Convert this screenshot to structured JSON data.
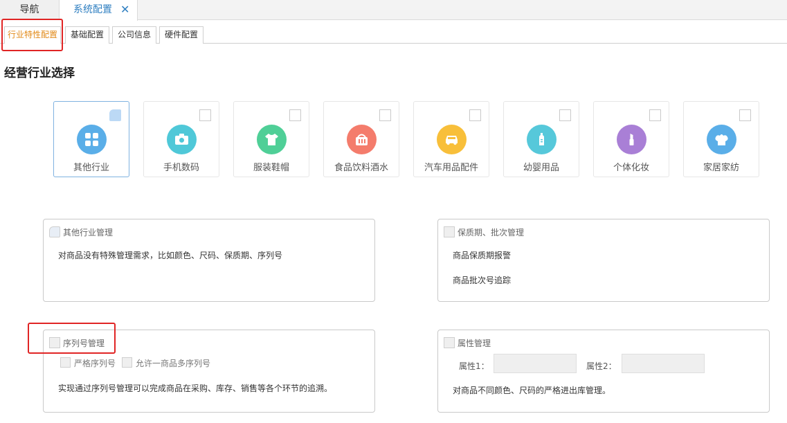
{
  "top_tabs": {
    "nav_label": "导航",
    "system_label": "系统配置",
    "close_glyph": "✕"
  },
  "sub_tabs": [
    {
      "label": "行业特性配置",
      "active": true
    },
    {
      "label": "基础配置",
      "active": false
    },
    {
      "label": "公司信息",
      "active": false
    },
    {
      "label": "硬件配置",
      "active": false
    }
  ],
  "section_title": "经营行业选择",
  "industries": [
    {
      "label": "其他行业",
      "icon": "grid-icon",
      "color": "#5aaee8",
      "selected": true
    },
    {
      "label": "手机数码",
      "icon": "camera-icon",
      "color": "#4fc8d8",
      "selected": false
    },
    {
      "label": "服装鞋帽",
      "icon": "shirt-icon",
      "color": "#4fcf97",
      "selected": false
    },
    {
      "label": "食品饮料酒水",
      "icon": "food-basket-icon",
      "color": "#f47c6c",
      "selected": false
    },
    {
      "label": "汽车用品配件",
      "icon": "car-icon",
      "color": "#f8bf3a",
      "selected": false
    },
    {
      "label": "幼婴用品",
      "icon": "baby-bottle-icon",
      "color": "#56c8da",
      "selected": false
    },
    {
      "label": "个体化妆",
      "icon": "lipstick-icon",
      "color": "#a97fd6",
      "selected": false
    },
    {
      "label": "家居家纺",
      "icon": "chef-hat-icon",
      "color": "#5aaee8",
      "selected": false
    }
  ],
  "panels": {
    "other": {
      "title": "其他行业管理",
      "desc": "对商品没有特殊管理需求，比如颜色、尺码、保质期、序列号"
    },
    "expiry": {
      "title": "保质期、批次管理",
      "line1": "商品保质期报警",
      "line2": "商品批次号追踪"
    },
    "serial": {
      "title": "序列号管理",
      "opt1": "严格序列号",
      "opt2": "允许一商品多序列号",
      "desc": "实现通过序列号管理可以完成商品在采购、库存、销售等各个环节的追溯。"
    },
    "attr": {
      "title": "属性管理",
      "attr1_label": "属性1：",
      "attr2_label": "属性2：",
      "desc": "对商品不同颜色、尺码的严格进出库管理。"
    }
  }
}
